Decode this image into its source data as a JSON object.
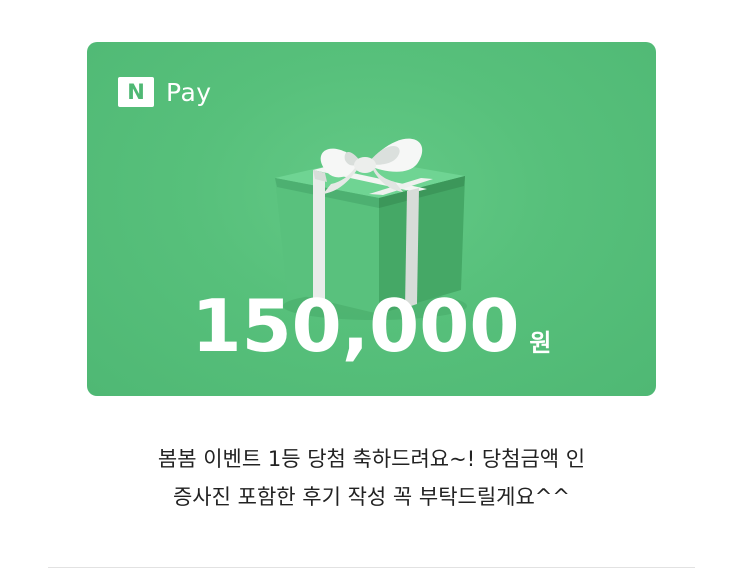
{
  "card": {
    "logo_badge": "N",
    "logo_text": "Pay",
    "amount_value": "150,000",
    "amount_unit": "원",
    "icon": "gift-box-icon",
    "colors": {
      "card_background": "#57c07b",
      "text": "#ffffff"
    }
  },
  "message": {
    "line1": "봄봄 이벤트 1등 당첨 축하드려요~! 당첨금액 인",
    "line2": "증사진 포함한 후기 작성 꼭 부탁드릴게요^^"
  }
}
